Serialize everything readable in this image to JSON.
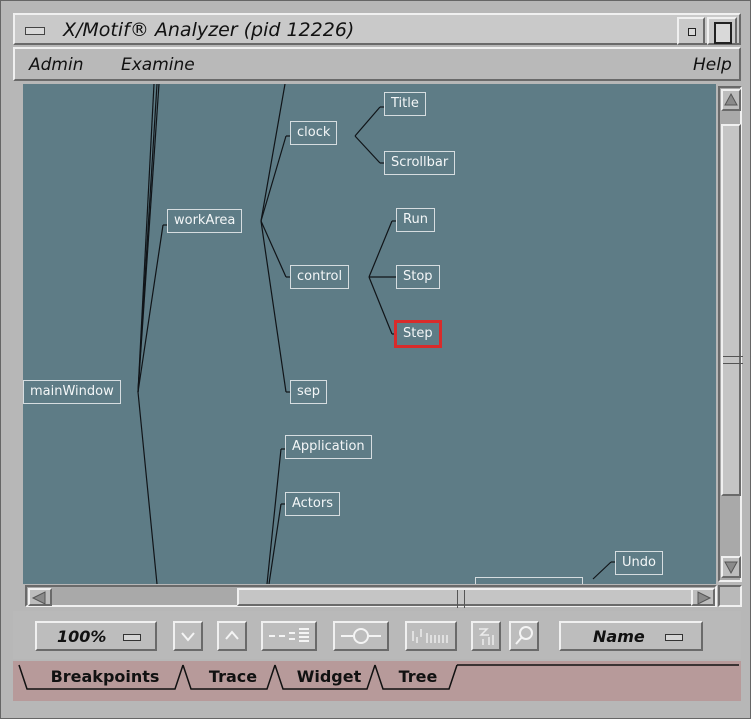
{
  "window": {
    "title": "X/Motif® Analyzer (pid 12226)"
  },
  "menubar": {
    "admin": "Admin",
    "examine": "Examine",
    "help": "Help"
  },
  "tree": {
    "nodes": {
      "mainWindow": "mainWindow",
      "workArea": "workArea",
      "clock": "clock",
      "title": "Title",
      "scrollbar": "Scrollbar",
      "control": "control",
      "run": "Run",
      "stop": "Stop",
      "step": "Step",
      "sep": "sep",
      "application": "Application",
      "actors": "Actors",
      "undo": "Undo"
    },
    "selected": "Step",
    "selection_color": "#d92b2b",
    "background_color": "#5e7c86"
  },
  "toolbar": {
    "zoom": "100%",
    "sort": "Name",
    "icons": [
      "down-arrow-icon",
      "up-arrow-icon",
      "collapse-tree-icon",
      "center-node-icon",
      "layout-icon",
      "reorient-icon",
      "find-icon"
    ]
  },
  "tabs": [
    "Breakpoints",
    "Trace",
    "Widget",
    "Tree"
  ],
  "active_tab": "Tree"
}
